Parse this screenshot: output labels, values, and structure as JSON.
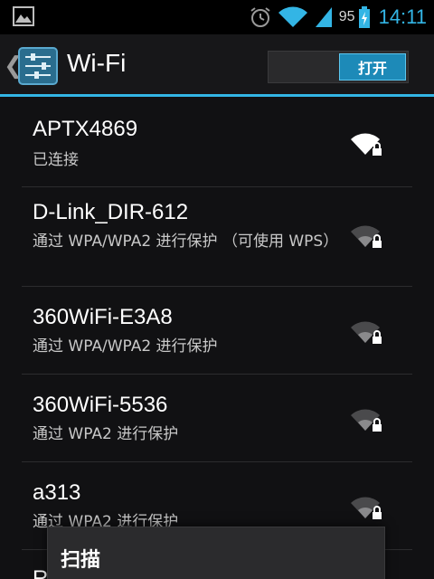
{
  "status_bar": {
    "battery_level": "95",
    "time": "14:11",
    "icons": [
      "image-icon",
      "alarm-icon",
      "wifi-signal-icon",
      "cell-signal-icon",
      "battery-charging-icon"
    ]
  },
  "action_bar": {
    "title": "Wi-Fi",
    "toggle_label": "打开",
    "accent_color": "#33b5e5"
  },
  "networks": [
    {
      "ssid": "APTX4869",
      "status": "已连接",
      "signal": "strong-locked"
    },
    {
      "ssid": "D-Link_DIR-612",
      "status": "通过 WPA/WPA2 进行保护 （可使用 WPS）",
      "signal": "weak-locked"
    },
    {
      "ssid": "360WiFi-E3A8",
      "status": "通过 WPA/WPA2 进行保护",
      "signal": "weak-locked"
    },
    {
      "ssid": "360WiFi-5536",
      "status": "通过 WPA2 进行保护",
      "signal": "weak-locked"
    },
    {
      "ssid": "a313",
      "status": "通过 WPA2 进行保护",
      "signal": "weak-locked"
    }
  ],
  "partial_next_ssid": "R",
  "popup": {
    "label": "扫描"
  }
}
